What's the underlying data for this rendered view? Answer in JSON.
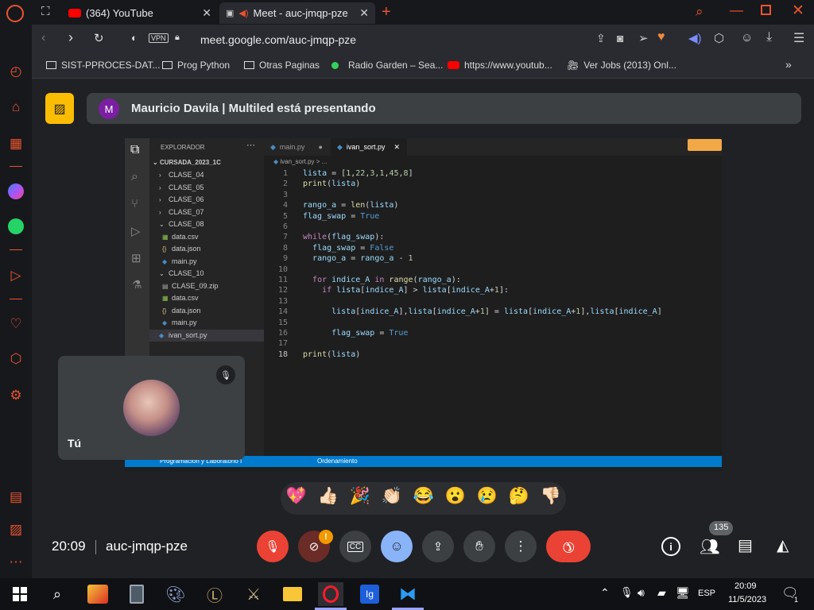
{
  "browser": {
    "tabs": [
      {
        "label": "(364) YouTube"
      },
      {
        "label": "Meet - auc-jmqp-pze"
      }
    ],
    "url": "meet.google.com/auc-jmqp-pze",
    "vpn_label": "VPN",
    "bookmarks": [
      {
        "label": "SIST-PPROCES-DAT..."
      },
      {
        "label": "Prog Python"
      },
      {
        "label": "Otras Paginas"
      },
      {
        "label": "Radio Garden – Sea..."
      },
      {
        "label": "https://www.youtub..."
      },
      {
        "label": "Ver Jobs (2013) Onl..."
      }
    ],
    "accent": "#e8542f"
  },
  "meet": {
    "presenter_initial": "M",
    "presenting_text": "Mauricio Davila | Multiled está presentando",
    "self_label": "Tú",
    "time": "20:09",
    "meeting_code": "auc-jmqp-pze",
    "participants_count": "135",
    "reactions": [
      "💖",
      "👍🏻",
      "🎉",
      "👏🏻",
      "😂",
      "😮",
      "😢",
      "🤔",
      "👎🏻"
    ],
    "end_call_color": "#ea4335"
  },
  "vscode": {
    "explorer_title": "EXPLORADOR",
    "folder_root": "CURSADA_2023_1C",
    "tree": [
      {
        "label": "CLASE_04",
        "type": "folder",
        "indent": 1,
        "open": false
      },
      {
        "label": "CLASE_05",
        "type": "folder",
        "indent": 1,
        "open": false
      },
      {
        "label": "CLASE_06",
        "type": "folder",
        "indent": 1,
        "open": false
      },
      {
        "label": "CLASE_07",
        "type": "folder",
        "indent": 1,
        "open": false
      },
      {
        "label": "CLASE_08",
        "type": "folder",
        "indent": 1,
        "open": true
      },
      {
        "label": "data.csv",
        "type": "csv",
        "indent": 2
      },
      {
        "label": "data.json",
        "type": "json",
        "indent": 2
      },
      {
        "label": "main.py",
        "type": "py",
        "indent": 2
      },
      {
        "label": "CLASE_10",
        "type": "folder",
        "indent": 1,
        "open": true
      },
      {
        "label": "CLASE_09.zip",
        "type": "zip",
        "indent": 2
      },
      {
        "label": "data.csv",
        "type": "csv",
        "indent": 2
      },
      {
        "label": "data.json",
        "type": "json",
        "indent": 2
      },
      {
        "label": "main.py",
        "type": "py",
        "indent": 2
      },
      {
        "label": "ivan_sort.py",
        "type": "py",
        "indent": 1,
        "selected": true
      }
    ],
    "tabs": [
      {
        "label": "main.py"
      },
      {
        "label": "ivan_sort.py"
      }
    ],
    "breadcrumb": "ivan_sort.py > ...",
    "code_lines": [
      "lista = [1,22,3,1,45,8]",
      "print(lista)",
      "",
      "rango_a = len(lista)",
      "flag_swap = True",
      "",
      "while(flag_swap):",
      "  flag_swap = False",
      "  rango_a = rango_a - 1",
      "",
      "  for indice_A in range(rango_a):",
      "    if lista[indice_A] > lista[indice_A+1]:",
      "",
      "      lista[indice_A],lista[indice_A+1] = lista[indice_A+1],lista[indice_A]",
      "",
      "      flag_swap = True",
      "",
      "print(lista)"
    ],
    "status_left": "Programacion y Laboratorio I",
    "status_right": "Ordenamiento"
  },
  "taskbar": {
    "lang": "ESP",
    "clock_time": "20:09",
    "clock_date": "11/5/2023",
    "notifications": "1"
  }
}
